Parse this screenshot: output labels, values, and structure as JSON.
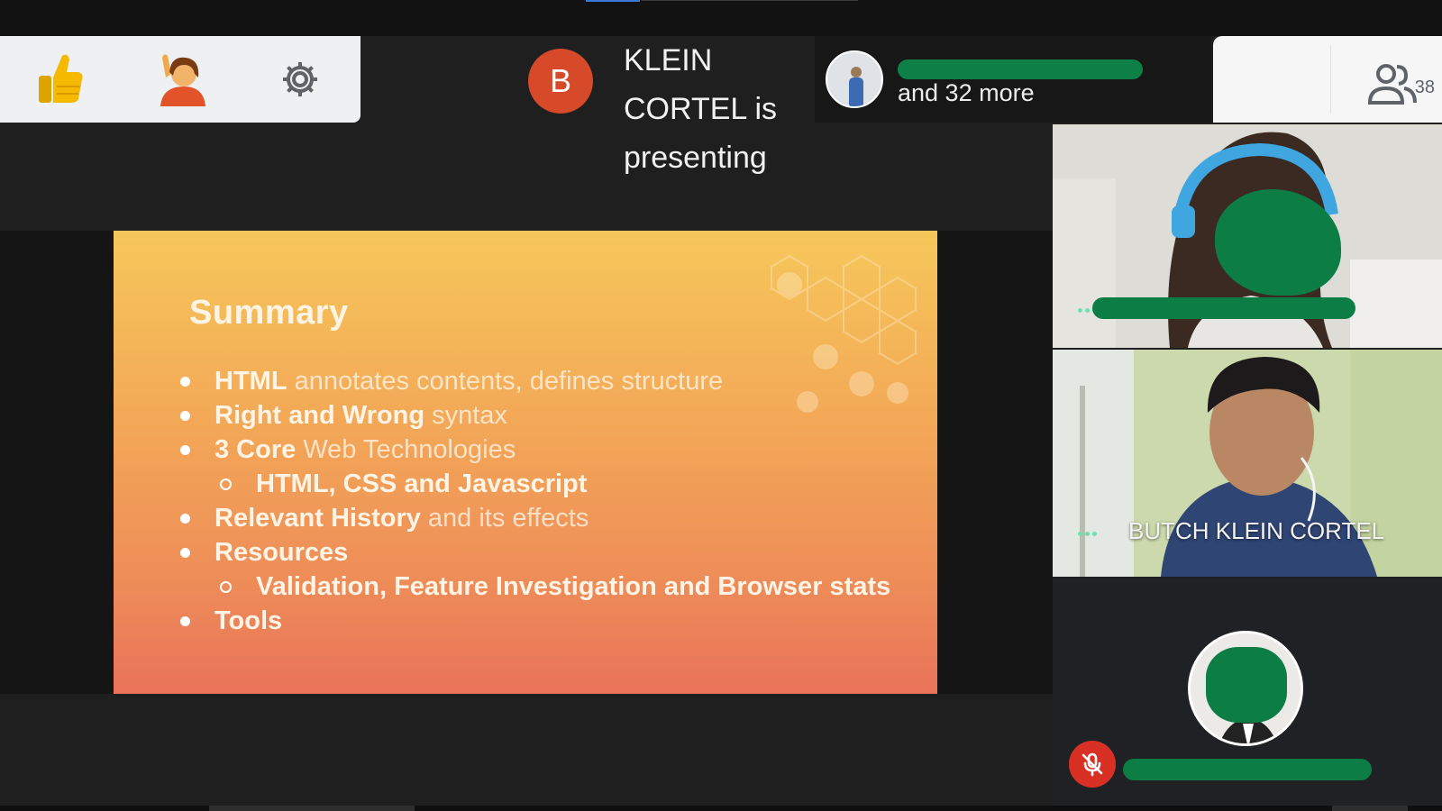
{
  "reactions": {
    "thumbs_up": "👍",
    "raise_hand": "🙋",
    "settings_icon": "gear-icon"
  },
  "presenter": {
    "avatar_letter": "B",
    "line1": "KLEIN",
    "line2": "CORTEL is",
    "line3": "presenting",
    "avatar_color": "#d64a2a"
  },
  "participants_chip": {
    "more_text": "and 32 more"
  },
  "people_button": {
    "count": "38"
  },
  "slide": {
    "title": "Summary",
    "items": [
      {
        "bold": "HTML",
        "rest": " annotates contents, defines structure",
        "level": 1
      },
      {
        "bold": "Right and Wrong",
        "rest": " syntax",
        "level": 1
      },
      {
        "bold": "3 Core",
        "rest": " Web Technologies",
        "level": 1
      },
      {
        "bold": "HTML, CSS and Javascript",
        "rest": "",
        "level": 2
      },
      {
        "bold": "Relevant History",
        "rest": " and its effects",
        "level": 1
      },
      {
        "bold": "Resources",
        "rest": "",
        "level": 1
      },
      {
        "bold": "Validation, Feature Investigation and Browser stats",
        "rest": "",
        "level": 2
      },
      {
        "bold": "Tools",
        "rest": "",
        "level": 1
      }
    ]
  },
  "tiles": {
    "tile2_name": "BUTCH KLEIN CORTEL"
  },
  "colors": {
    "redaction": "#0b7d45",
    "mic_off": "#d93025"
  }
}
